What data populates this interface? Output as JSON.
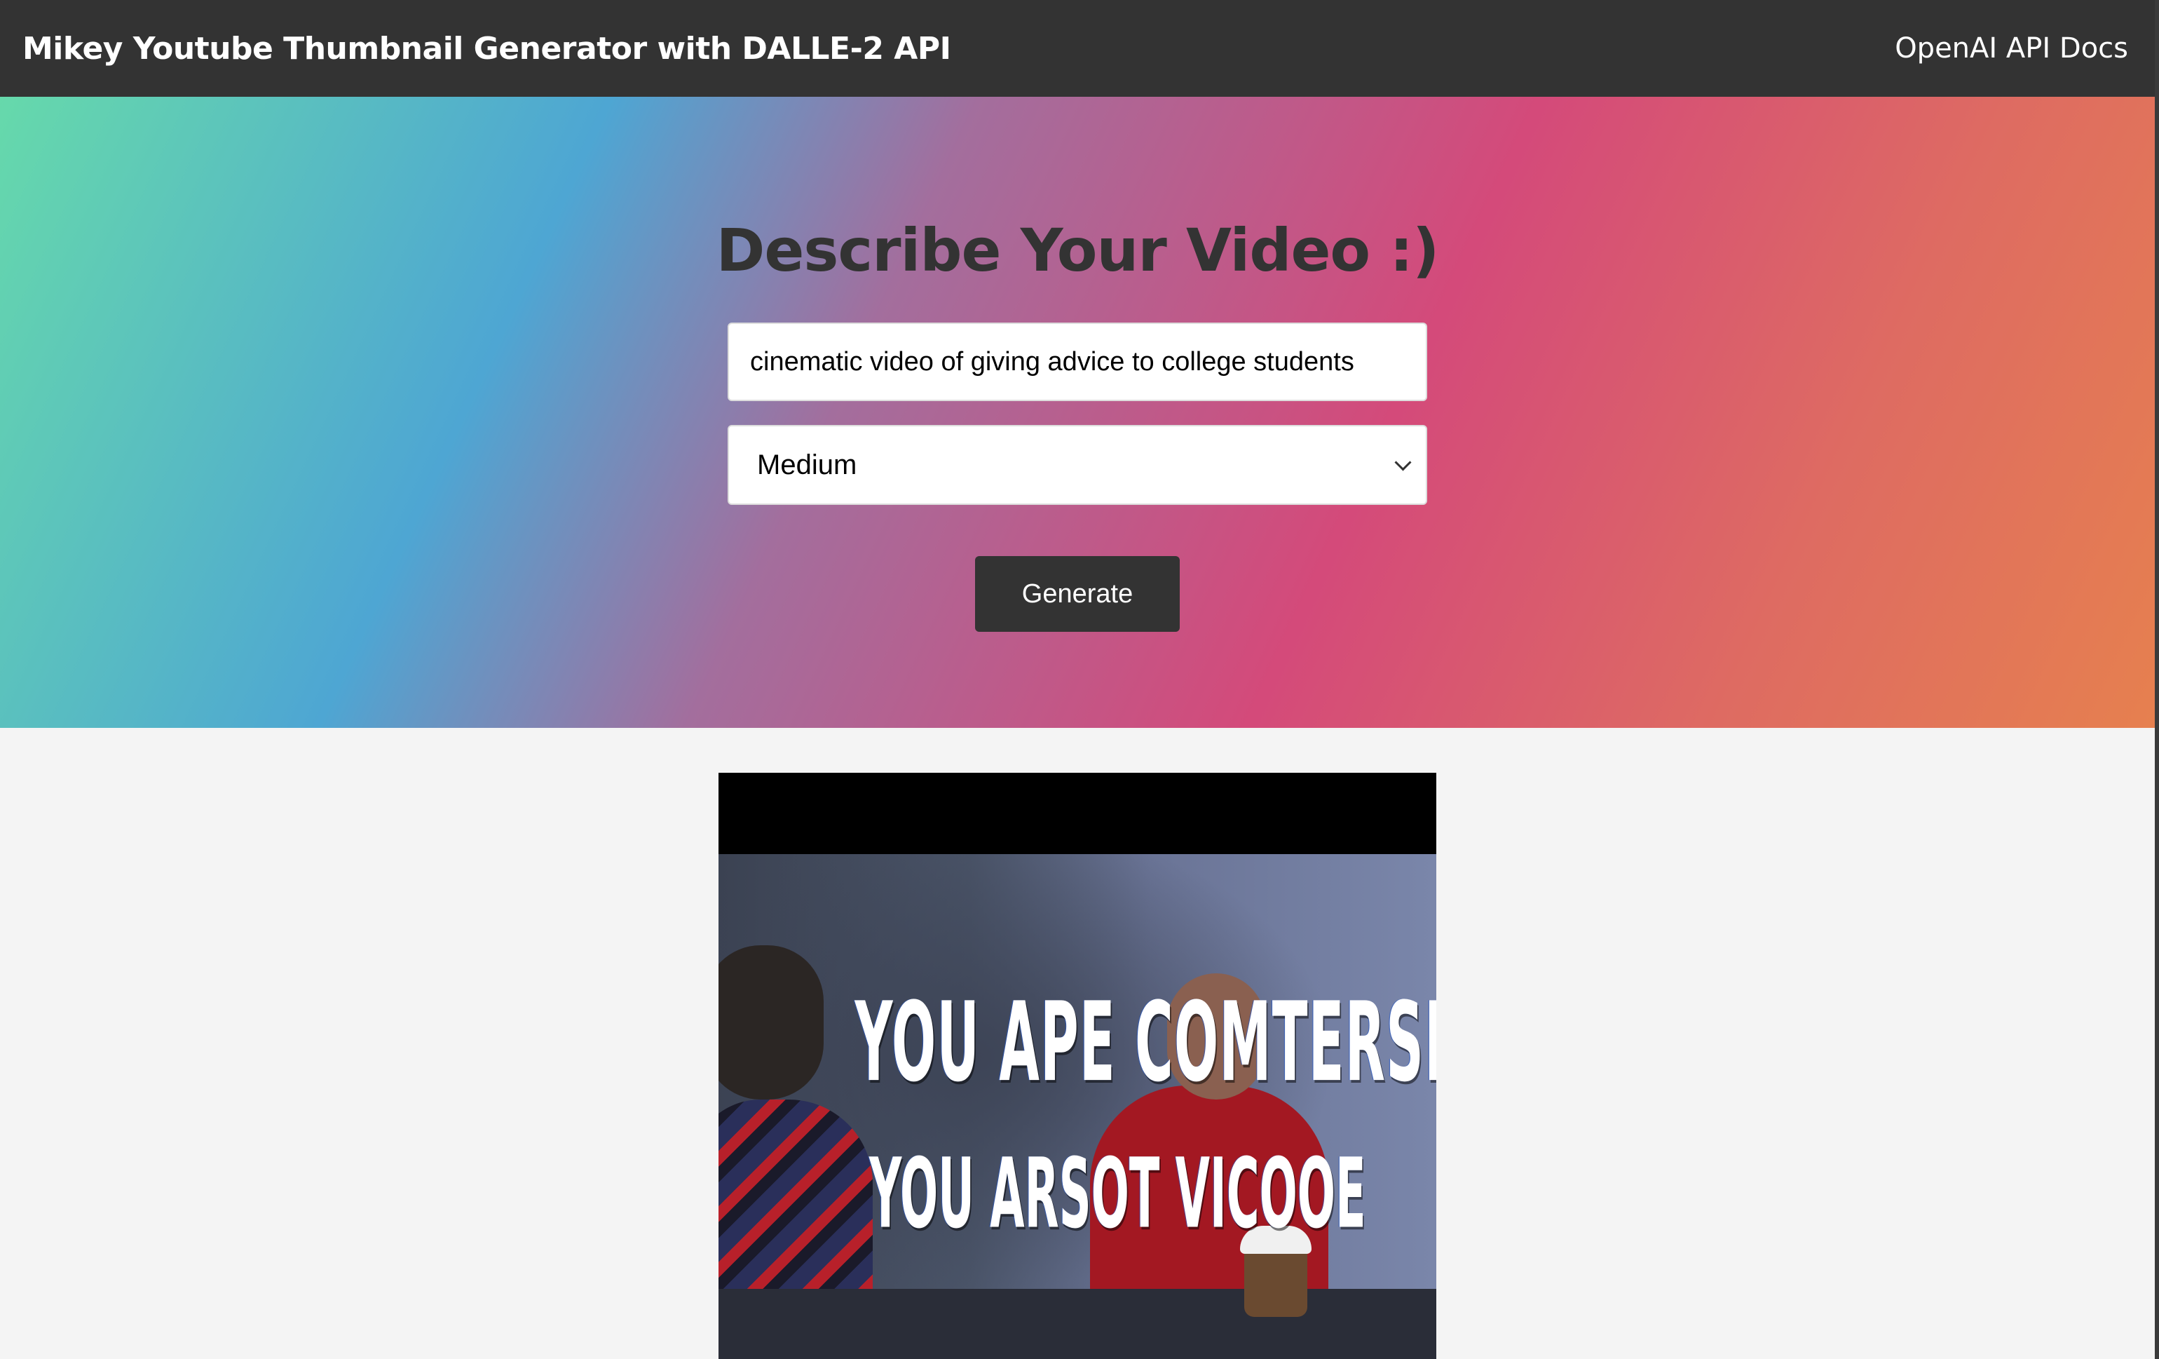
{
  "navbar": {
    "logo": "Mikey Youtube Thumbnail Generator with DALLE-2 API",
    "docs_link": "OpenAI API Docs"
  },
  "showcase": {
    "heading": "Describe Your Video :)",
    "prompt_value": "cinematic video of giving advice to college students",
    "size_select": {
      "selected": "Medium"
    },
    "generate_label": "Generate",
    "gradient_colors": [
      "#66d9ab",
      "#4ea6d3",
      "#a36e9d",
      "#d44a7a",
      "#de6b62",
      "#e6804f"
    ]
  },
  "result": {
    "image_text_line1": "YOU APE COMTERSE",
    "image_text_line2": "YOU ARSOT VICOOE"
  },
  "colors": {
    "navbar_bg": "#333333",
    "page_bg": "#f4f4f4",
    "button_bg": "#333333",
    "heading_text": "#333333"
  }
}
